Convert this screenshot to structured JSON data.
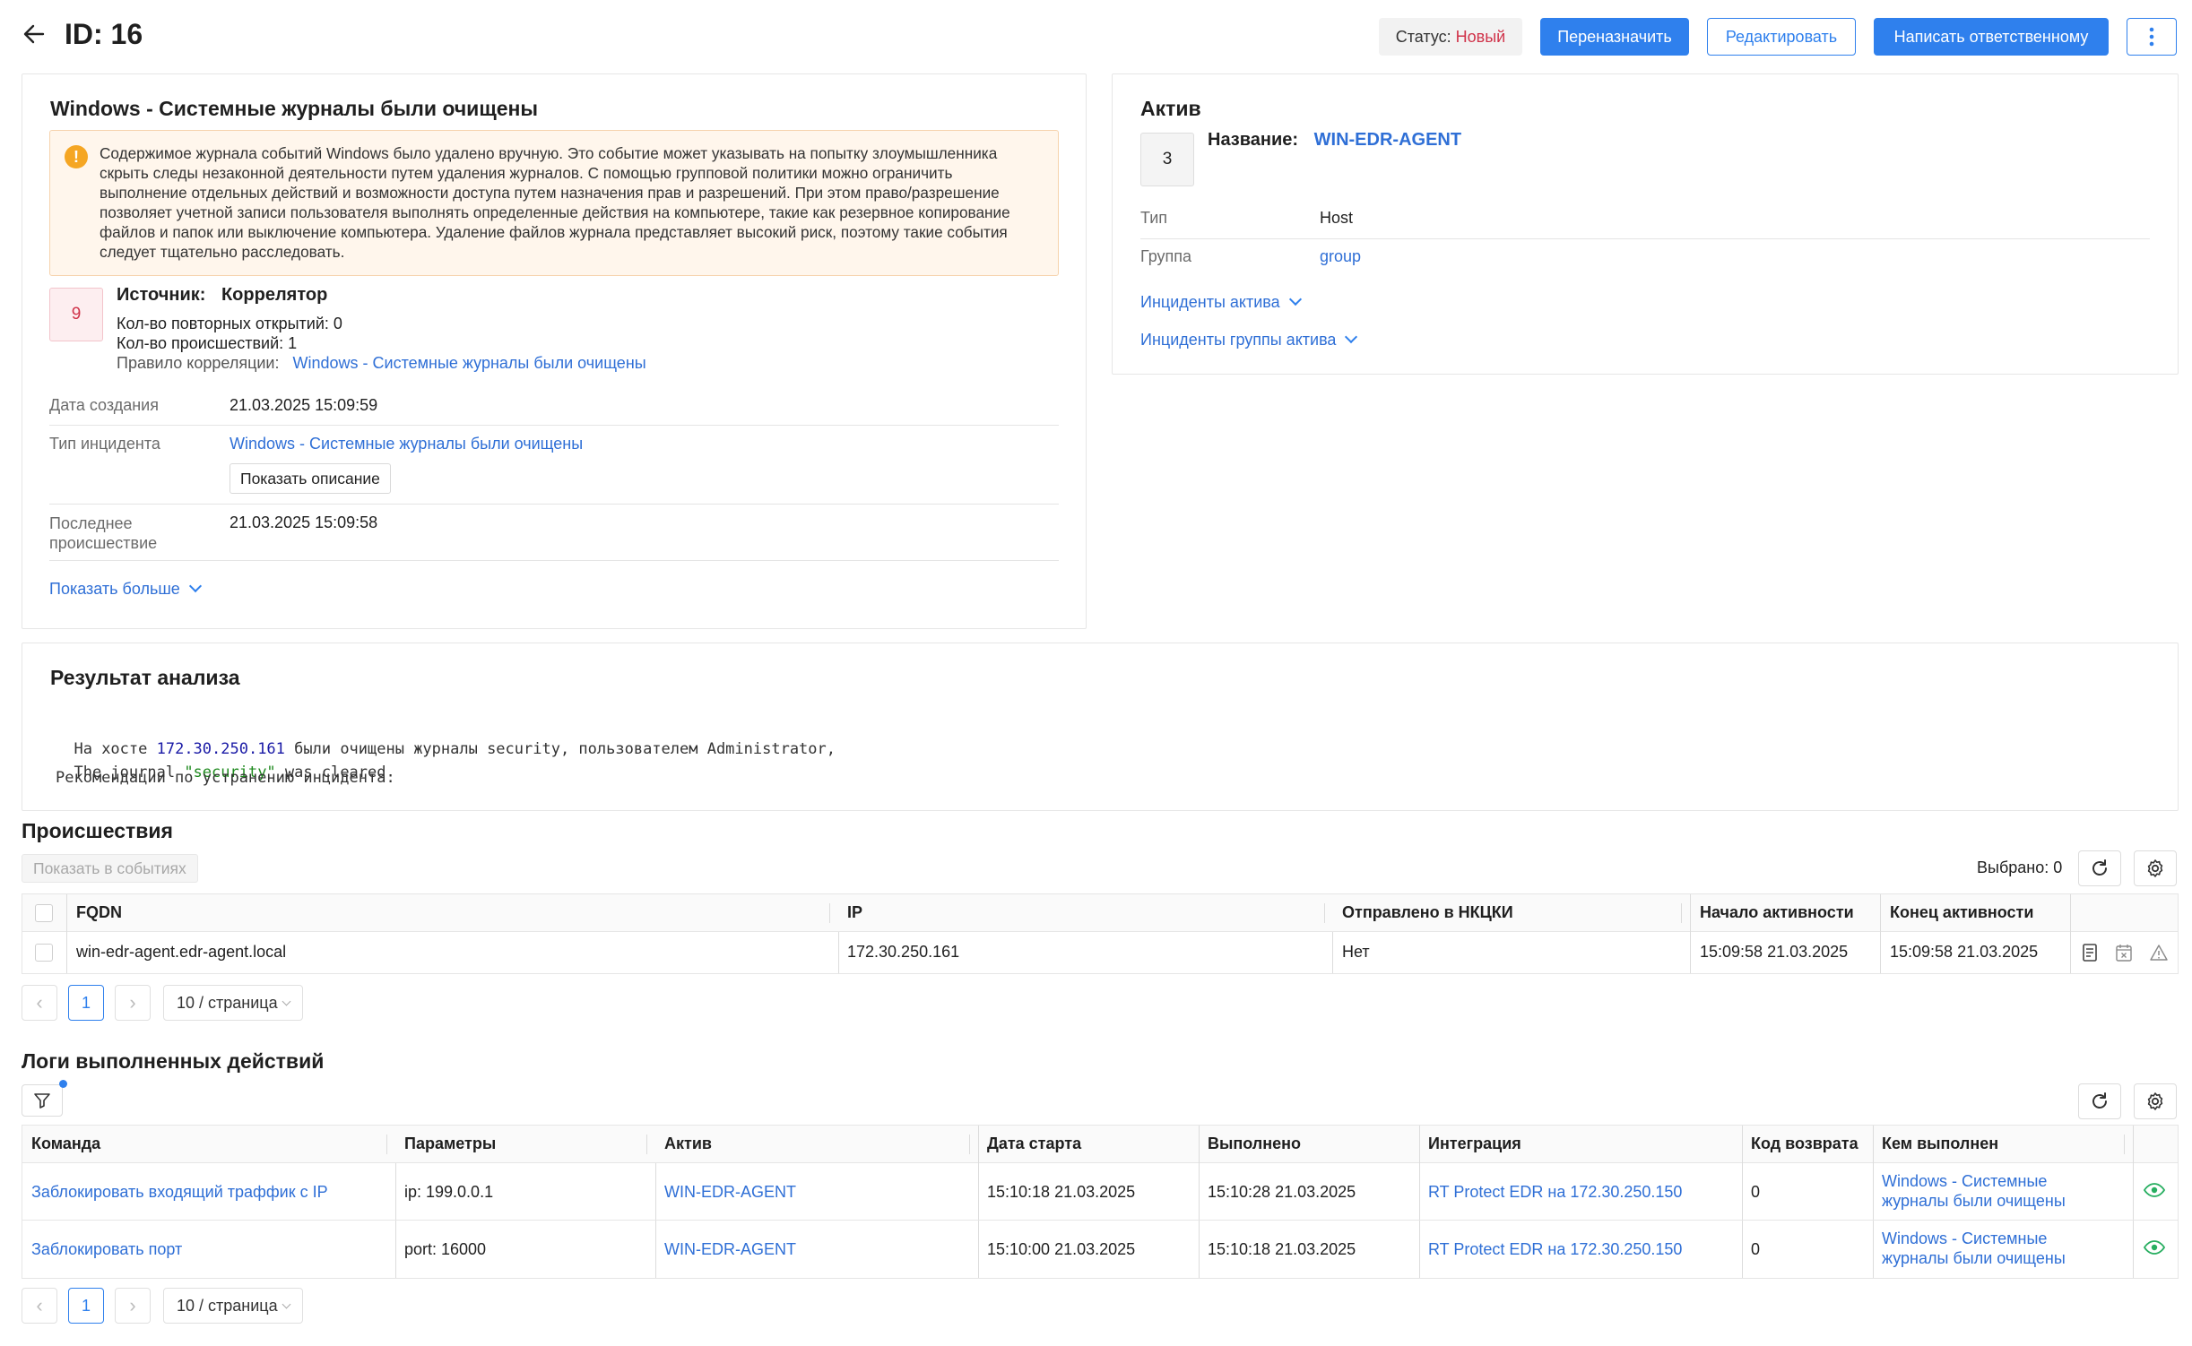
{
  "header": {
    "title": "ID: 16",
    "status_label": "Статус: ",
    "status_value": "Новый",
    "reassign_label": "Переназначить",
    "edit_label": "Редактировать",
    "write_label": "Написать ответственному"
  },
  "incident": {
    "title": "Windows - Системные журналы были очищены",
    "warning": "Содержимое журнала событий Windows было удалено вручную. Это событие может указывать на попытку злоумышленника скрыть следы незаконной деятельности путем удаления журналов. С помощью групповой политики можно ограничить выполнение отдельных действий и возможности доступа путем назначения прав и разрешений. При этом право/разрешение позволяет учетной записи пользователя выполнять определенные действия на компьютере, такие как резервное копирование файлов и папок или выключение компьютера. Удаление файлов журнала представляет высокий риск, поэтому такие события следует тщательно расследовать.",
    "severity": "9",
    "source_label": "Источник:",
    "source_value": "Коррелятор",
    "reopen_count": "Кол-во повторных открытий: 0",
    "events_count": "Кол-во происшествий: 1",
    "rule_label": "Правило корреляции:",
    "rule_value": "Windows - Системные журналы были очищены",
    "created_label": "Дата создания",
    "created_value": "21.03.2025 15:09:59",
    "type_label": "Тип инцидента",
    "type_value": "Windows - Системные журналы были очищены",
    "show_desc_label": "Показать описание",
    "last_label_1": "Последнее",
    "last_label_2": "происшествие",
    "last_value": "21.03.2025 15:09:58",
    "show_more_label": "Показать больше"
  },
  "asset": {
    "title": "Актив",
    "badge": "3",
    "name_label": "Название:",
    "name_value": "WIN-EDR-AGENT",
    "type_label": "Тип",
    "type_value": "Host",
    "group_label": "Группа",
    "group_value": "group",
    "incidents_link": "Инциденты актива",
    "group_incidents_link": "Инциденты группы актива"
  },
  "analysis": {
    "title": "Результат анализа",
    "line1_pre": "На хосте ",
    "line1_ip": "172.30.250.161",
    "line1_post": " были очищены журналы security, пользователем Administrator,",
    "line2_pre": "The journal ",
    "line2_str": "\"security\"",
    "line2_post": " was cleared",
    "line3": "Рекомендации по устранению инцидента:"
  },
  "events": {
    "title": "Происшествия",
    "show_in_events": "Показать в событиях",
    "selected": "Выбрано: 0",
    "columns": [
      "FQDN",
      "IP",
      "Отправлено в НКЦКИ",
      "Начало активности",
      "Конец активности"
    ],
    "rows": [
      {
        "fqdn": "win-edr-agent.edr-agent.local",
        "ip": "172.30.250.161",
        "sent": "Нет",
        "start": "15:09:58 21.03.2025",
        "end": "15:09:58 21.03.2025"
      }
    ],
    "page": "1",
    "page_size": "10 / страница"
  },
  "logs": {
    "title": "Логи выполненных действий",
    "columns": [
      "Команда",
      "Параметры",
      "Актив",
      "Дата старта",
      "Выполнено",
      "Интеграция",
      "Код возврата",
      "Кем выполнен"
    ],
    "rows": [
      {
        "cmd": "Заблокировать входящий траффик с IP",
        "params": "ip: 199.0.0.1",
        "asset": "WIN-EDR-AGENT",
        "start": "15:10:18 21.03.2025",
        "done": "15:10:28 21.03.2025",
        "integration": "RT Protect EDR на 172.30.250.150",
        "code": "0",
        "by1": "Windows - Системные",
        "by2": "журналы были очищены"
      },
      {
        "cmd": "Заблокировать порт",
        "params": "port: 16000",
        "asset": "WIN-EDR-AGENT",
        "start": "15:10:00 21.03.2025",
        "done": "15:10:18 21.03.2025",
        "integration": "RT Protect EDR на 172.30.250.150",
        "code": "0",
        "by1": "Windows - Системные",
        "by2": "журналы были очищены"
      }
    ],
    "page": "1",
    "page_size": "10 / страница"
  },
  "colors": {
    "accent": "#2f80ed",
    "status_new": "#d0334a",
    "warning_bg": "#fff6ec",
    "warning_border": "#f6d3ad",
    "warning_icon": "#f5a623",
    "severity_bg": "#fdeef0",
    "severity_text": "#d0334a",
    "eye": "#27ae60"
  }
}
